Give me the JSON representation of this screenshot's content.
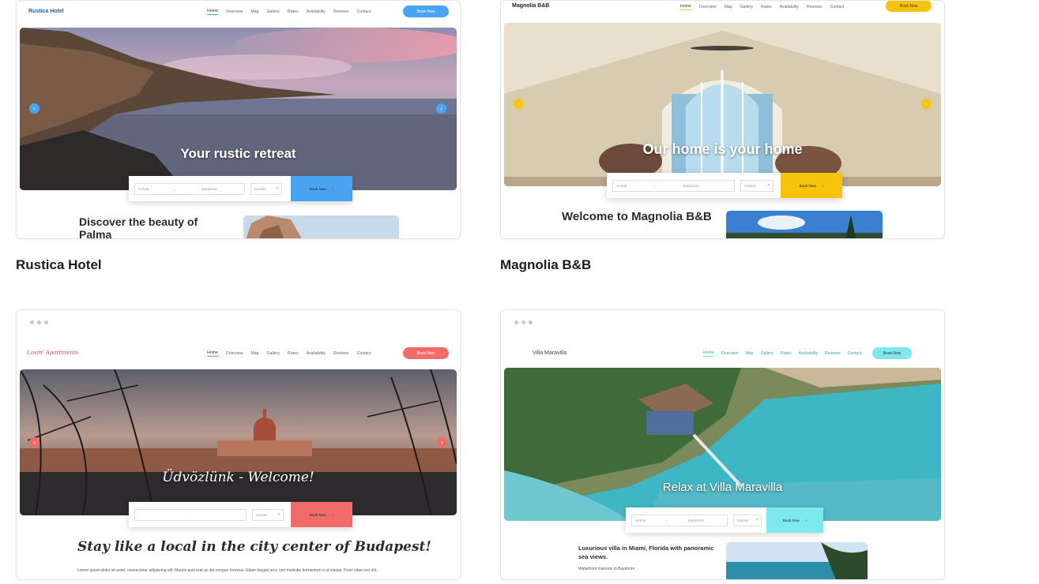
{
  "templates": [
    {
      "title": "Rustica Hotel",
      "logo": "Rustica Hotel",
      "nav": [
        "Home",
        "Overview",
        "Map",
        "Gallery",
        "Rates",
        "Availability",
        "Reviews",
        "Contact"
      ],
      "book_now": "Book Now",
      "hero_title": "Your rustic retreat",
      "arrival": "Arrival",
      "departure": "Departure",
      "guests": "Guests",
      "section_title": "Discover the beauty of Palma",
      "accent": "#4aa3f0"
    },
    {
      "title": "Magnolia B&B",
      "logo": "Magnolia B&B",
      "nav": [
        "Home",
        "Overview",
        "Map",
        "Gallery",
        "Rates",
        "Availability",
        "Reviews",
        "Contact"
      ],
      "book_now": "Book Now",
      "hero_title": "Our home is your home",
      "arrival": "Arrival",
      "departure": "Departure",
      "guests": "Guests",
      "section_title": "Welcome to Magnolia B&B",
      "accent": "#f6c20a"
    },
    {
      "title": "",
      "logo": "Lovin' Apartments",
      "nav": [
        "Home",
        "Overview",
        "Map",
        "Gallery",
        "Rates",
        "Availability",
        "Reviews",
        "Contact"
      ],
      "book_now": "Book Now",
      "hero_title": "Üdvözlünk - Welcome!",
      "guests": "Guests",
      "section_title": "Stay like a local in the city center of Budapest!",
      "body_text": "Lorem ipsum dolor sit amet, consectetur adipiscing elit. Mauris quis erat ac dui congue rhoncus. Etiam feugiat arcu non molestie fermentum a ut massa. Proin vitae orci elit.",
      "accent": "#f26b6b"
    },
    {
      "title": "",
      "logo": "Villa Maravilla",
      "nav": [
        "Home",
        "Overview",
        "Map",
        "Gallery",
        "Rates",
        "Availability",
        "Reviews",
        "Contact"
      ],
      "book_now": "Book Now",
      "hero_title": "Relax at Villa Maravilla",
      "arrival": "Arrival",
      "departure": "Departure",
      "guests": "Guests",
      "section_title": "Luxurious villa in Miami, Florida with panoramic sea views.",
      "subtitle": "Waterfront mansion in Bayshore",
      "accent": "#7de8ee"
    }
  ]
}
